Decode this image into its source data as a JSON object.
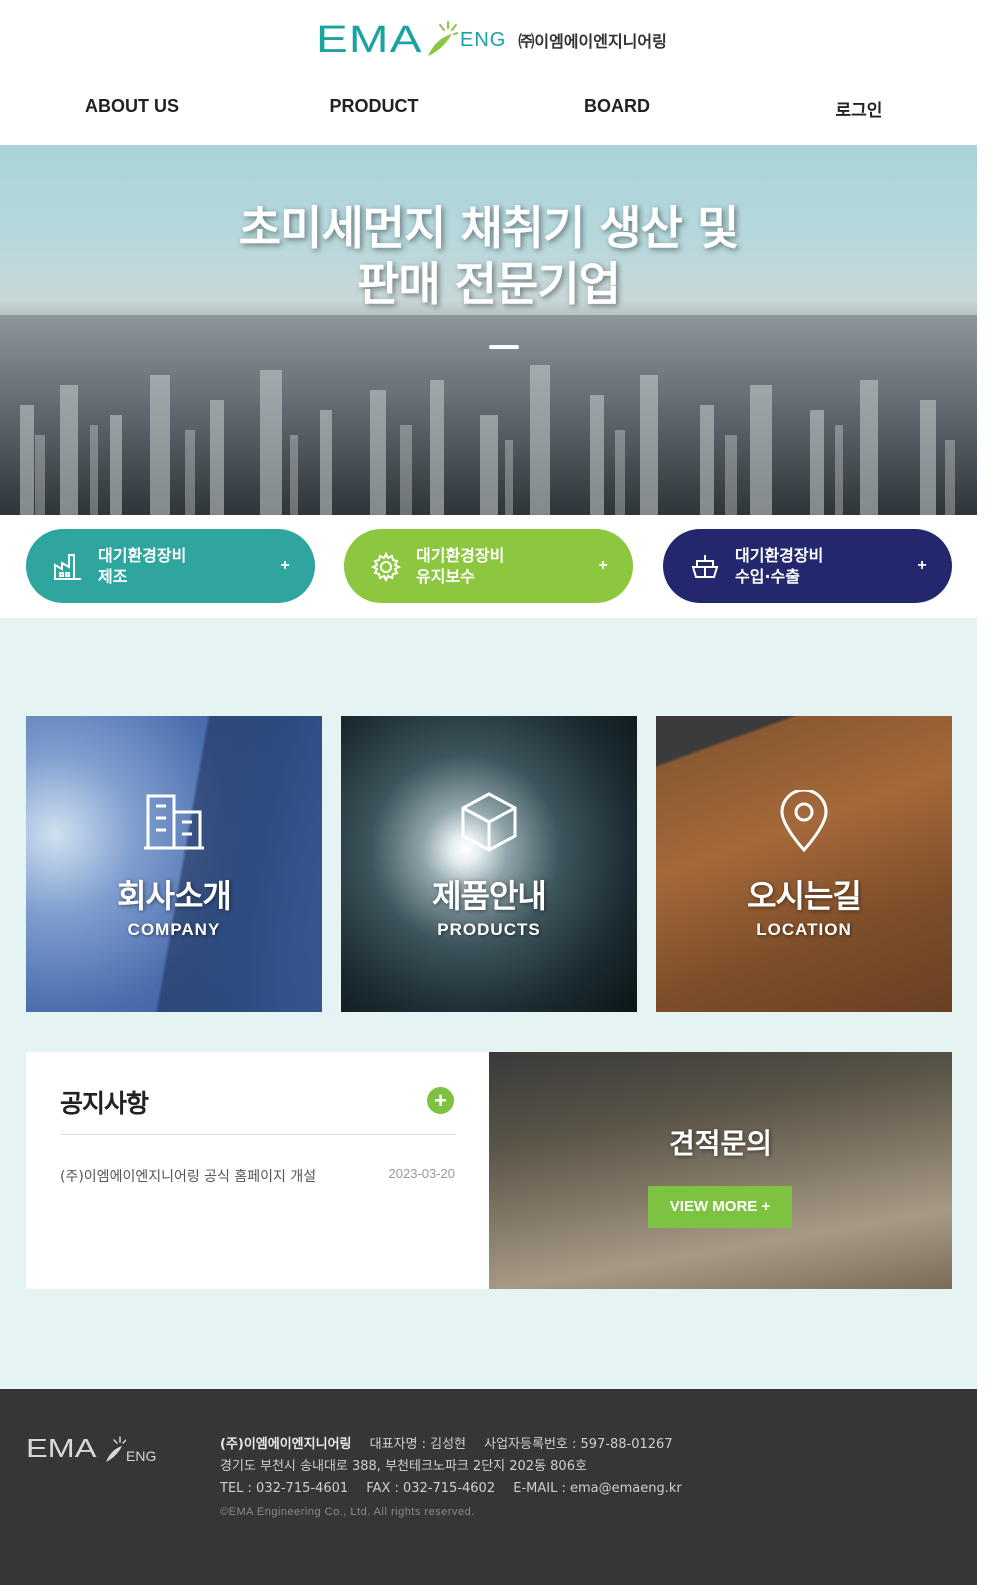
{
  "brand": {
    "logo_ema": "EMA",
    "logo_eng": "ENG",
    "company_kr": "㈜이엠에이엔지니어링"
  },
  "nav": {
    "items": [
      "ABOUT US",
      "PRODUCT",
      "BOARD",
      "로그인"
    ]
  },
  "hero": {
    "title_line1": "초미세먼지 채취기 생산 및",
    "title_line2": "판매 전문기업"
  },
  "services": [
    {
      "line1": "대기환경장비",
      "line2": "제조",
      "icon": "factory-icon",
      "color": "#2fa59f"
    },
    {
      "line1": "대기환경장비",
      "line2": "유지보수",
      "icon": "gear-icon",
      "color": "#8dc63f"
    },
    {
      "line1": "대기환경장비",
      "line2": "수입·수출",
      "icon": "ship-icon",
      "color": "#23286e"
    }
  ],
  "cards": [
    {
      "title": "회사소개",
      "sub": "COMPANY",
      "icon": "building-icon"
    },
    {
      "title": "제품안내",
      "sub": "PRODUCTS",
      "icon": "box-icon"
    },
    {
      "title": "오시는길",
      "sub": "LOCATION",
      "icon": "location-pin-icon"
    }
  ],
  "notice": {
    "title": "공지사항",
    "plus": "+",
    "items": [
      {
        "text": "(주)이엠에이엔지니어링 공식 홈페이지 개설",
        "date": "2023-03-20"
      }
    ]
  },
  "quote": {
    "title": "견적문의",
    "button": "VIEW MORE +"
  },
  "footer": {
    "logo_ema": "EMA",
    "logo_eng": "ENG",
    "company": "(주)이엠에이엔지니어링",
    "ceo": "대표자명 : 김성현",
    "biz_no": "사업자등록번호 : 597-88-01267",
    "address": "경기도 부천시 송내대로 388, 부천테크노파크 2단지 202동 806호",
    "tel": "TEL : 032-715-4601",
    "fax": "FAX : 032-715-4602",
    "email": "E-MAIL : ema@emaeng.kr",
    "copyright": "©EMA Engineering Co., Ltd. All rights reserved."
  },
  "colors": {
    "teal": "#1aa3a0",
    "green": "#7dc240",
    "navy": "#23286e",
    "bg_light": "#e5f3f3",
    "footer_bg": "#363636"
  }
}
